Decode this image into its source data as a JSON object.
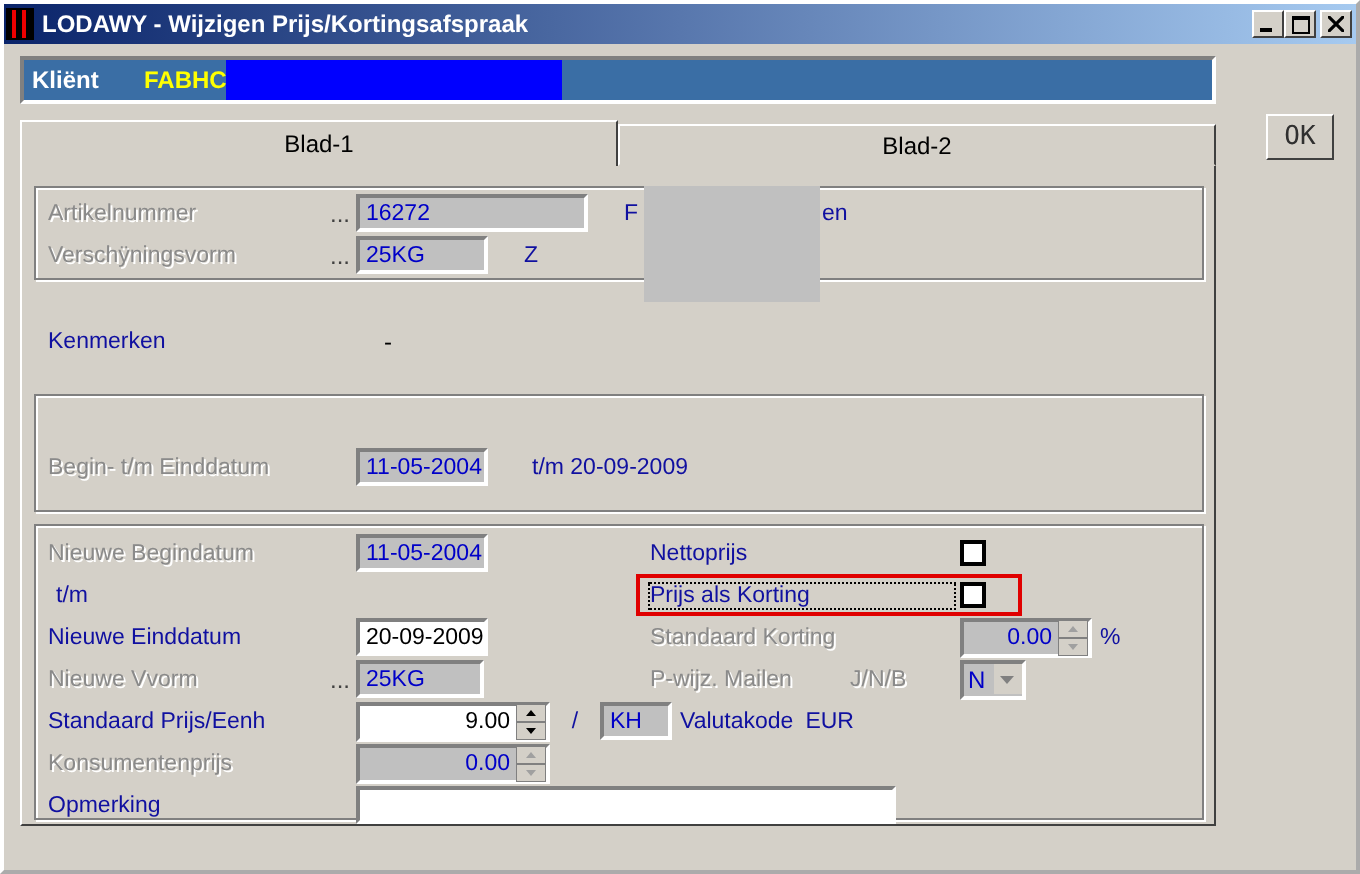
{
  "window": {
    "title": "LODAWY - Wijzigen Prijs/Kortingsafspraak"
  },
  "client": {
    "label": "Kliënt",
    "value": "FABHC"
  },
  "tabs": [
    {
      "label": "Blad-1",
      "selected": true
    },
    {
      "label": "Blad-2",
      "selected": false
    }
  ],
  "ok_button": "OK",
  "article": [
    {
      "label": "Artikelnummer",
      "lookup": "...",
      "value": "16272",
      "disabled": true,
      "side": [
        "F",
        "en"
      ]
    },
    {
      "label": "Verschÿningsvorm",
      "lookup": "...",
      "value": "25KG",
      "disabled": true,
      "side": [
        "Z"
      ]
    }
  ],
  "kenmerken": {
    "label": "Kenmerken",
    "value": "-"
  },
  "period": {
    "label": "Begin- t/m Einddatum",
    "value": "11-05-2004",
    "until": "t/m 20-09-2009",
    "disabled": true
  },
  "form": {
    "nieuwe_begindatum": {
      "label": "Nieuwe Begindatum",
      "value": "11-05-2004",
      "disabled": true
    },
    "tm": "t/m",
    "nieuwe_einddatum": {
      "label": "Nieuwe Einddatum",
      "value": "20-09-2009",
      "disabled": false
    },
    "nieuwe_vvorm": {
      "label": "Nieuwe Vvorm",
      "lookup": "...",
      "value": "25KG",
      "disabled": true
    },
    "standaard_prijs": {
      "label": "Standaard Prijs/Eenh",
      "value": "9.00",
      "disabled": false,
      "separator": "/",
      "unit": "KH",
      "currency_label": "Valutakode",
      "currency": "EUR"
    },
    "konsumentenprijs": {
      "label": "Konsumentenprijs",
      "value": "0.00",
      "disabled": true
    },
    "opmerking": {
      "label": "Opmerking",
      "disabled": false
    },
    "nettoprijs": {
      "label": "Nettoprijs",
      "checked": false,
      "focused": false,
      "highlighted": false
    },
    "prijs_als_korting": {
      "label": "Prijs als Korting",
      "checked": false,
      "focused": true,
      "highlighted": true
    },
    "standaard_korting": {
      "label": "Standaard Korting",
      "value": "0.00",
      "unit": "%",
      "disabled": true
    },
    "mailen": {
      "label": "P-wijz. Mailen",
      "hint": "J/N/B",
      "value": "N",
      "disabled": true
    }
  }
}
